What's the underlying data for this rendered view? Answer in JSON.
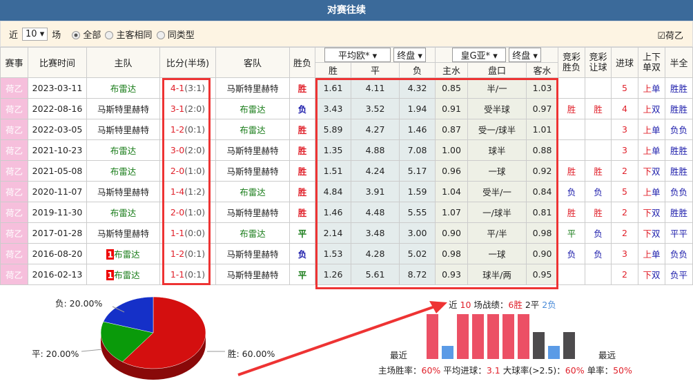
{
  "title": "对赛往续",
  "filter": {
    "prefix": "近",
    "count": "10 ▾",
    "suffix": "场",
    "options": [
      "全部",
      "主客相同",
      "同类型"
    ],
    "league_check": "荷乙"
  },
  "headers": {
    "league": "赛事",
    "time": "比赛时间",
    "home": "主队",
    "score": "比分(半场)",
    "away": "客队",
    "result": "胜负",
    "euro_select": "平均欧*  ▾",
    "euro_type": "终盘 ▾",
    "asia_select": "皇G亚*  ▾",
    "asia_type": "终盘 ▾",
    "win": "胜",
    "draw": "平",
    "lose": "负",
    "home_water": "主水",
    "handicap": "盘口",
    "away_water": "客水",
    "jc_result": "竞彩胜负",
    "jc_handicap": "竞彩让球",
    "goals": "进球",
    "ou": "上下单双",
    "ht_ft": "半全"
  },
  "rows": [
    {
      "league": "荷乙",
      "date": "2023-03-11",
      "home": "布雷达",
      "home_badge": "",
      "score": "4-1",
      "half": "(3:1)",
      "away": "马斯特里赫特",
      "res": "胜",
      "w": "1.61",
      "d": "4.11",
      "l": "4.32",
      "hw": "0.85",
      "hc": "半/一",
      "aw": "1.03",
      "jr": "",
      "jh": "",
      "goals": "5",
      "ou1": "上",
      "ou2": "单",
      "hf": "胜胜"
    },
    {
      "league": "荷乙",
      "date": "2022-08-16",
      "home": "马斯特里赫特",
      "home_badge": "",
      "score": "3-1",
      "half": "(2:0)",
      "away": "布雷达",
      "res": "负",
      "w": "3.43",
      "d": "3.52",
      "l": "1.94",
      "hw": "0.91",
      "hc": "受半球",
      "aw": "0.97",
      "jr": "胜",
      "jh": "胜",
      "goals": "4",
      "ou1": "上",
      "ou2": "双",
      "hf": "胜胜"
    },
    {
      "league": "荷乙",
      "date": "2022-03-05",
      "home": "马斯特里赫特",
      "home_badge": "",
      "score": "1-2",
      "half": "(0:1)",
      "away": "布雷达",
      "res": "胜",
      "w": "5.89",
      "d": "4.27",
      "l": "1.46",
      "hw": "0.87",
      "hc": "受一/球半",
      "aw": "1.01",
      "jr": "",
      "jh": "",
      "goals": "3",
      "ou1": "上",
      "ou2": "单",
      "hf": "负负"
    },
    {
      "league": "荷乙",
      "date": "2021-10-23",
      "home": "布雷达",
      "home_badge": "",
      "score": "3-0",
      "half": "(2:0)",
      "away": "马斯特里赫特",
      "res": "胜",
      "w": "1.35",
      "d": "4.88",
      "l": "7.08",
      "hw": "1.00",
      "hc": "球半",
      "aw": "0.88",
      "jr": "",
      "jh": "",
      "goals": "3",
      "ou1": "上",
      "ou2": "单",
      "hf": "胜胜"
    },
    {
      "league": "荷乙",
      "date": "2021-05-08",
      "home": "布雷达",
      "home_badge": "",
      "score": "2-0",
      "half": "(1:0)",
      "away": "马斯特里赫特",
      "res": "胜",
      "w": "1.51",
      "d": "4.24",
      "l": "5.17",
      "hw": "0.96",
      "hc": "一球",
      "aw": "0.92",
      "jr": "胜",
      "jh": "胜",
      "goals": "2",
      "ou1": "下",
      "ou2": "双",
      "hf": "胜胜"
    },
    {
      "league": "荷乙",
      "date": "2020-11-07",
      "home": "马斯特里赫特",
      "home_badge": "",
      "score": "1-4",
      "half": "(1:2)",
      "away": "布雷达",
      "res": "胜",
      "w": "4.84",
      "d": "3.91",
      "l": "1.59",
      "hw": "1.04",
      "hc": "受半/一",
      "aw": "0.84",
      "jr": "负",
      "jh": "负",
      "goals": "5",
      "ou1": "上",
      "ou2": "单",
      "hf": "负负"
    },
    {
      "league": "荷乙",
      "date": "2019-11-30",
      "home": "布雷达",
      "home_badge": "",
      "score": "2-0",
      "half": "(1:0)",
      "away": "马斯特里赫特",
      "res": "胜",
      "w": "1.46",
      "d": "4.48",
      "l": "5.55",
      "hw": "1.07",
      "hc": "一/球半",
      "aw": "0.81",
      "jr": "胜",
      "jh": "胜",
      "goals": "2",
      "ou1": "下",
      "ou2": "双",
      "hf": "胜胜"
    },
    {
      "league": "荷乙",
      "date": "2017-01-28",
      "home": "马斯特里赫特",
      "home_badge": "",
      "score": "1-1",
      "half": "(0:0)",
      "away": "布雷达",
      "res": "平",
      "w": "2.14",
      "d": "3.48",
      "l": "3.00",
      "hw": "0.90",
      "hc": "平/半",
      "aw": "0.98",
      "jr": "平",
      "jh": "负",
      "goals": "2",
      "ou1": "下",
      "ou2": "双",
      "hf": "平平"
    },
    {
      "league": "荷乙",
      "date": "2016-08-20",
      "home": "布雷达",
      "home_badge": "1",
      "score": "1-2",
      "half": "(0:1)",
      "away": "马斯特里赫特",
      "res": "负",
      "w": "1.53",
      "d": "4.28",
      "l": "5.02",
      "hw": "0.98",
      "hc": "一球",
      "aw": "0.90",
      "jr": "负",
      "jh": "负",
      "goals": "3",
      "ou1": "上",
      "ou2": "单",
      "hf": "负负"
    },
    {
      "league": "荷乙",
      "date": "2016-02-13",
      "home": "布雷达",
      "home_badge": "1",
      "score": "1-1",
      "half": "(0:1)",
      "away": "马斯特里赫特",
      "res": "平",
      "w": "1.26",
      "d": "5.61",
      "l": "8.72",
      "hw": "0.93",
      "hc": "球半/两",
      "aw": "0.95",
      "jr": "",
      "jh": "",
      "goals": "2",
      "ou1": "下",
      "ou2": "双",
      "hf": "负平"
    }
  ],
  "pie": {
    "slices": [
      {
        "label": "胜: 60.00%",
        "value": 60,
        "color": "#d40f0f"
      },
      {
        "label": "平: 20.00%",
        "value": 20,
        "color": "#0a9a0a"
      },
      {
        "label": "负: 20.00%",
        "value": 20,
        "color": "#1530c8"
      }
    ]
  },
  "summary": {
    "p1": "近",
    "n": "10",
    "p2": "场战绩：",
    "wins": "6胜",
    "draws": "2平",
    "losses": "2负",
    "recent": "最近",
    "oldest": "最远",
    "bars": [
      "胜",
      "负",
      "胜",
      "胜",
      "胜",
      "胜",
      "胜",
      "平",
      "负",
      "平"
    ],
    "stats": [
      {
        "label": "主场胜率：",
        "value": "60%"
      },
      {
        "label": "平均进球：",
        "value": "3.1"
      },
      {
        "label": "大球率(>2.5)：",
        "value": "60%"
      },
      {
        "label": "单率：",
        "value": "50%"
      }
    ]
  }
}
